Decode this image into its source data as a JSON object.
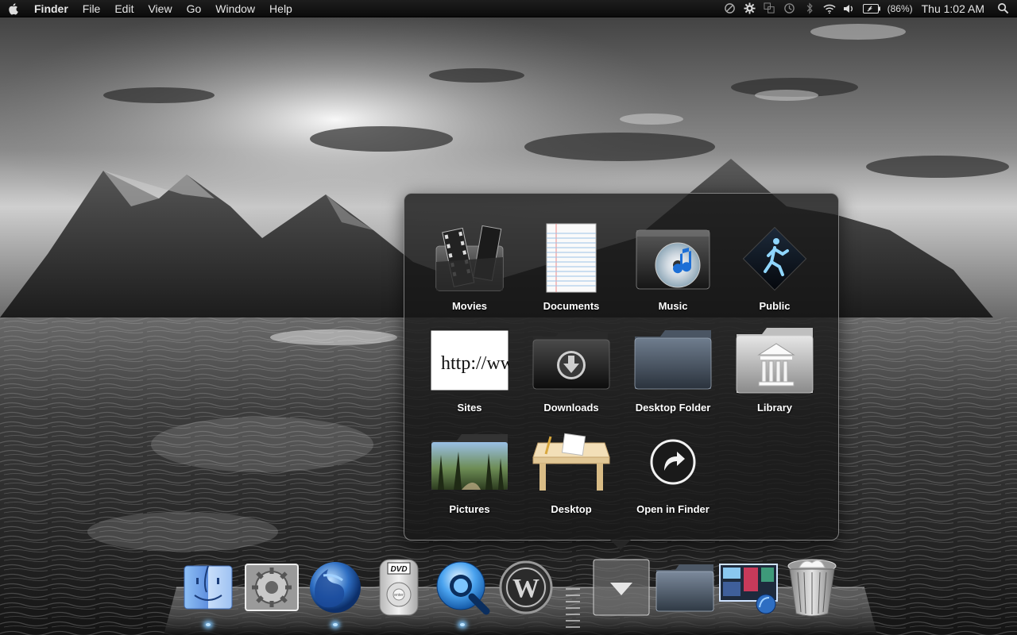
{
  "menubar": {
    "apple_icon": "apple-logo-icon",
    "app_name": "Finder",
    "menus": [
      "File",
      "Edit",
      "View",
      "Go",
      "Window",
      "Help"
    ],
    "status_icons": [
      "sync-icon",
      "gear-icon",
      "spaces-icon",
      "time-machine-icon",
      "bluetooth-icon",
      "wifi-icon",
      "volume-icon",
      "battery-icon"
    ],
    "battery_percent": "(86%)",
    "clock": "Thu 1:02 AM",
    "spotlight_icon": "spotlight-search-icon"
  },
  "stack": {
    "items": [
      {
        "label": "Movies",
        "icon": "movies-folder-icon"
      },
      {
        "label": "Documents",
        "icon": "documents-icon"
      },
      {
        "label": "Music",
        "icon": "music-folder-icon"
      },
      {
        "label": "Public",
        "icon": "public-folder-icon"
      },
      {
        "label": "Sites",
        "icon": "sites-folder-icon"
      },
      {
        "label": "Downloads",
        "icon": "downloads-folder-icon"
      },
      {
        "label": "Desktop Folder",
        "icon": "desktop-folder-icon"
      },
      {
        "label": "Library",
        "icon": "library-folder-icon"
      },
      {
        "label": "Pictures",
        "icon": "pictures-folder-icon"
      },
      {
        "label": "Desktop",
        "icon": "desktop-table-icon"
      },
      {
        "label": "Open in Finder",
        "icon": "open-in-finder-arrow-icon"
      }
    ],
    "sites_preview_text": "http://www."
  },
  "dock": {
    "items": [
      {
        "name": "finder-icon"
      },
      {
        "name": "system-preferences-icon"
      },
      {
        "name": "firefox-icon"
      },
      {
        "name": "dvd-player-icon",
        "badge_text": "DVD",
        "remote_text": "enter"
      },
      {
        "name": "quicktime-icon"
      },
      {
        "name": "world-of-warcraft-icon",
        "badge_text": "W"
      },
      {
        "name": "downloads-stack-icon"
      },
      {
        "name": "folder-stack-icon"
      },
      {
        "name": "screenshot-stack-icon"
      },
      {
        "name": "trash-icon"
      }
    ]
  },
  "colors": {
    "popup_background": "#181818",
    "popup_border": "#d2d2d2",
    "label_text": "#ffffff",
    "menubar_background": "#111111",
    "running_indicator": "#7fc7ff"
  }
}
